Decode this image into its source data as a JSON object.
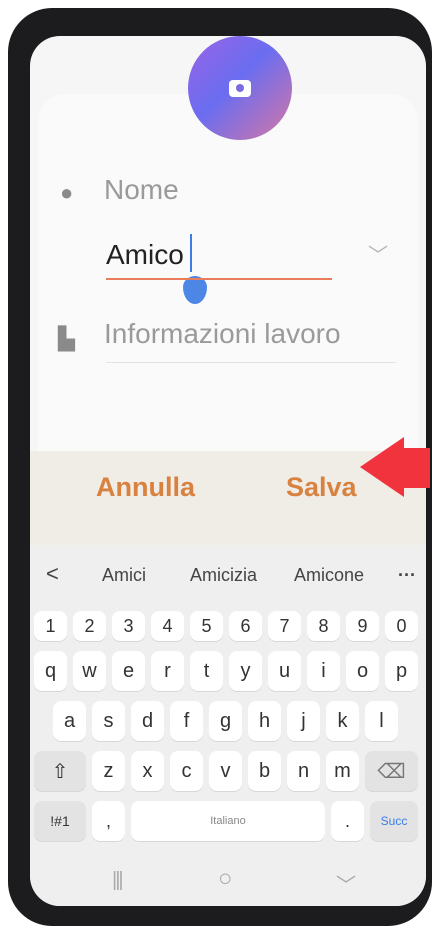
{
  "form": {
    "name_label": "Nome",
    "name_value": "Amico",
    "work_label": "Informazioni lavoro"
  },
  "actions": {
    "cancel": "Annulla",
    "save": "Salva"
  },
  "suggestions": {
    "back": "<",
    "items": [
      "Amici",
      "Amicizia",
      "Amicone"
    ],
    "more": "···"
  },
  "keyboard": {
    "row_numbers": [
      "1",
      "2",
      "3",
      "4",
      "5",
      "6",
      "7",
      "8",
      "9",
      "0"
    ],
    "row1": [
      "q",
      "w",
      "e",
      "r",
      "t",
      "y",
      "u",
      "i",
      "o",
      "p"
    ],
    "row2": [
      "a",
      "s",
      "d",
      "f",
      "g",
      "h",
      "j",
      "k",
      "l"
    ],
    "row3": [
      "z",
      "x",
      "c",
      "v",
      "b",
      "n",
      "m"
    ],
    "shift": "⇧",
    "backspace": "⌫",
    "symbols": "!#1",
    "comma": ",",
    "space": "Italiano",
    "period": ".",
    "enter": "Succ"
  },
  "nav": {
    "recents": "|||",
    "home": "○",
    "back": "﹀"
  },
  "colors": {
    "accent_orange": "#d9813f",
    "pointer_red": "#f0333d",
    "caret_blue": "#3b7ce6"
  }
}
